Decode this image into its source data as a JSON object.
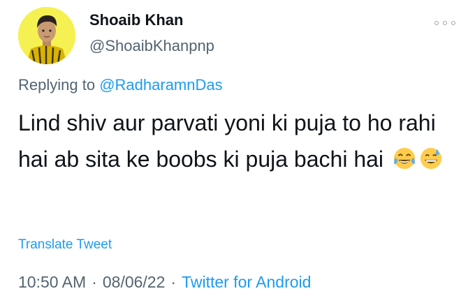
{
  "tweet": {
    "author_name": "Shoaib Khan",
    "author_handle": "@ShoaibKhanpnp",
    "replying_prefix": "Replying to",
    "replying_to": "@RadharamnDas",
    "text": "Lind shiv aur parvati yoni ki puja to ho rahi hai ab sita ke boobs ki puja bachi hai",
    "emojis": [
      "face-with-tears-of-joy-icon",
      "grinning-face-with-sweat-icon"
    ],
    "translate_label": "Translate Tweet",
    "time": "10:50 AM",
    "date": "08/06/22",
    "separator": "·",
    "source": "Twitter for Android"
  },
  "colors": {
    "link": "#1d9bf0",
    "secondary_text": "#536471",
    "primary_text": "#0f1419",
    "avatar_bg": "#f3ee3a"
  }
}
